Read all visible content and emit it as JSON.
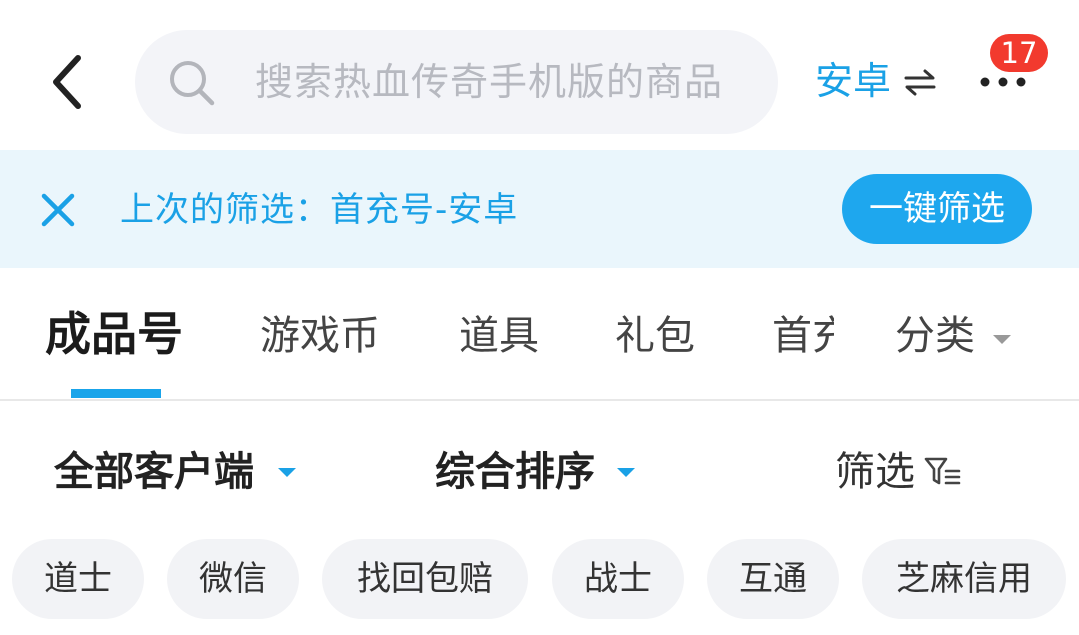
{
  "header": {
    "search_placeholder": "搜索热血传奇手机版的商品",
    "platform_label": "安卓",
    "notification_count": "17"
  },
  "filter_bar": {
    "last_filter_text": "上次的筛选：首充号-安卓",
    "one_key_button": "一键筛选"
  },
  "tabs": [
    {
      "label": "成品号",
      "active": true
    },
    {
      "label": "游戏币"
    },
    {
      "label": "道具"
    },
    {
      "label": "礼包"
    },
    {
      "label": "首充"
    },
    {
      "label": "分类"
    }
  ],
  "sort_row": {
    "client": "全部客户端",
    "sort": "综合排序",
    "filter": "筛选"
  },
  "chips": [
    "道士",
    "微信",
    "找回包赔",
    "战士",
    "互通",
    "芝麻信用"
  ],
  "colors": {
    "accent": "#1aa1e6",
    "badge": "#f23a2e",
    "filter_bar_bg": "#eaf6fc"
  }
}
